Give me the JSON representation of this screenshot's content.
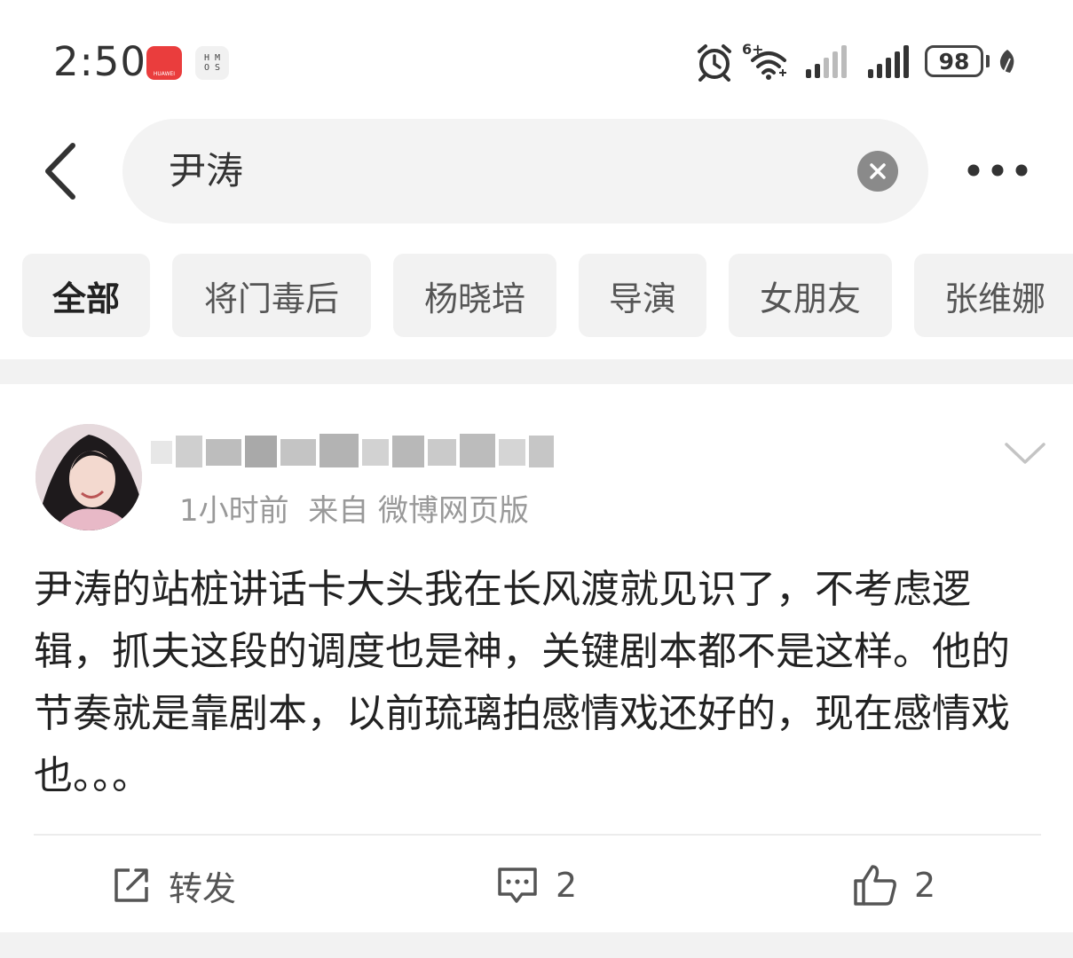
{
  "status_bar": {
    "time": "2:50",
    "huawei_app_label": "HUAWEI",
    "hmos_label": "H M\nO S",
    "network_label": "6+",
    "battery": "98"
  },
  "search": {
    "query": "尹涛"
  },
  "filter_tabs": [
    "全部",
    "将门毒后",
    "杨晓培",
    "导演",
    "女朋友",
    "张维娜"
  ],
  "post": {
    "meta": "1小时前  来自 微博网页版",
    "text": "尹涛的站桩讲话卡大头我在长风渡就见识了，不考虑逻辑，抓夫这段的调度也是神，关键剧本都不是这样。他的节奏就是靠剧本，以前琉璃拍感情戏还好的，现在感情戏也。。。",
    "repost_label": "转发",
    "comment_count": "2",
    "like_count": "2"
  },
  "colors": {
    "background": "#f2f2f2",
    "card": "#ffffff",
    "chip": "#f2f2f2",
    "meta_text": "#999999"
  }
}
